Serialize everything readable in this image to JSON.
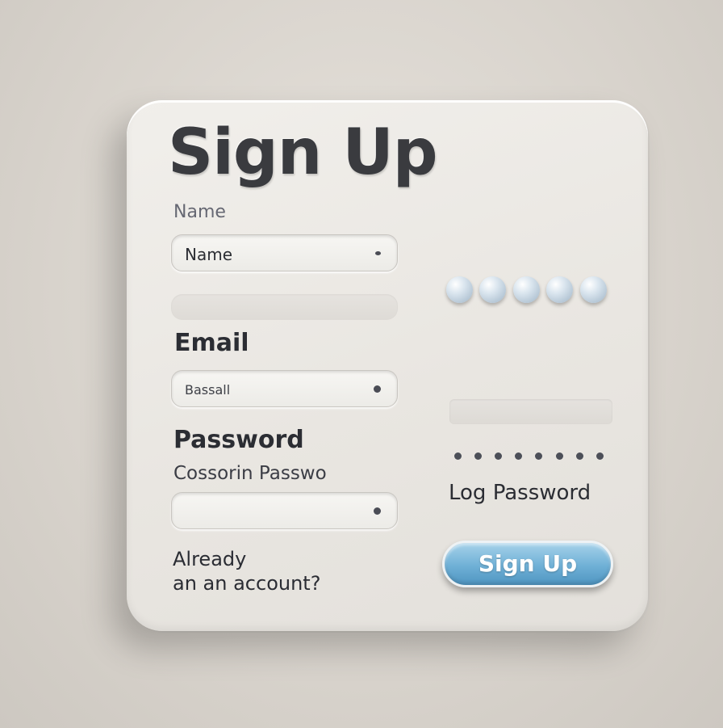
{
  "form": {
    "title": "Sign Up",
    "name_caption": "Name",
    "name_field": {
      "value": "Name"
    },
    "email_label": "Email",
    "email_field": {
      "value": "Bassall"
    },
    "password_label": "Password",
    "confirm_label": "Cossorin Passwo",
    "password_field": {
      "value": ""
    },
    "log_label": "Log Password",
    "already_line1": "Already",
    "already_line2": "an an account?",
    "submit_label": "Sign Up"
  },
  "colors": {
    "accent": "#6fb0d6",
    "background": "#d8d3cc",
    "card": "#ece9e4",
    "text": "#2b2d33"
  }
}
